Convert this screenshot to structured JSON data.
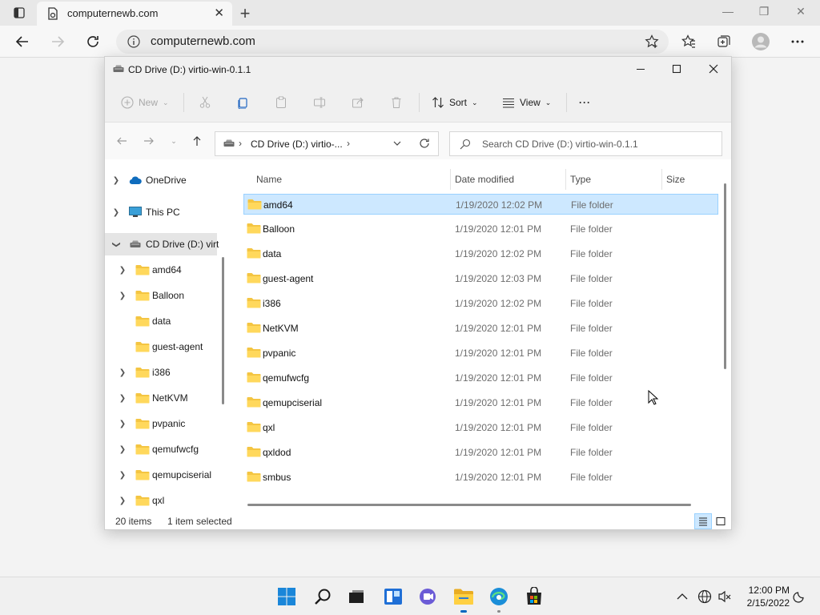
{
  "browser": {
    "tab_title": "computernewb.com",
    "url": "computernewb.com"
  },
  "explorer": {
    "title": "CD Drive (D:) virtio-win-0.1.1",
    "toolbar": {
      "new_label": "New",
      "sort_label": "Sort",
      "view_label": "View",
      "more_label": "···"
    },
    "breadcrumb": "CD Drive (D:) virtio-...",
    "search_placeholder": "Search CD Drive (D:) virtio-win-0.1.1",
    "sidebar": [
      {
        "label": "OneDrive",
        "icon": "onedrive-icon"
      },
      {
        "label": "This PC",
        "icon": "this-pc-icon"
      },
      {
        "label": "CD Drive (D:) virt",
        "icon": "cd-drive-icon"
      },
      {
        "label": "amd64",
        "icon": "folder-icon"
      },
      {
        "label": "Balloon",
        "icon": "folder-icon"
      },
      {
        "label": "data",
        "icon": "folder-icon"
      },
      {
        "label": "guest-agent",
        "icon": "folder-icon"
      },
      {
        "label": "i386",
        "icon": "folder-icon"
      },
      {
        "label": "NetKVM",
        "icon": "folder-icon"
      },
      {
        "label": "pvpanic",
        "icon": "folder-icon"
      },
      {
        "label": "qemufwcfg",
        "icon": "folder-icon"
      },
      {
        "label": "qemupciserial",
        "icon": "folder-icon"
      },
      {
        "label": "qxl",
        "icon": "folder-icon"
      }
    ],
    "columns": {
      "name": "Name",
      "date": "Date modified",
      "type": "Type",
      "size": "Size"
    },
    "files": [
      {
        "name": "amd64",
        "date": "1/19/2020 12:02 PM",
        "type": "File folder"
      },
      {
        "name": "Balloon",
        "date": "1/19/2020 12:01 PM",
        "type": "File folder"
      },
      {
        "name": "data",
        "date": "1/19/2020 12:02 PM",
        "type": "File folder"
      },
      {
        "name": "guest-agent",
        "date": "1/19/2020 12:03 PM",
        "type": "File folder"
      },
      {
        "name": "i386",
        "date": "1/19/2020 12:02 PM",
        "type": "File folder"
      },
      {
        "name": "NetKVM",
        "date": "1/19/2020 12:01 PM",
        "type": "File folder"
      },
      {
        "name": "pvpanic",
        "date": "1/19/2020 12:01 PM",
        "type": "File folder"
      },
      {
        "name": "qemufwcfg",
        "date": "1/19/2020 12:01 PM",
        "type": "File folder"
      },
      {
        "name": "qemupciserial",
        "date": "1/19/2020 12:01 PM",
        "type": "File folder"
      },
      {
        "name": "qxl",
        "date": "1/19/2020 12:01 PM",
        "type": "File folder"
      },
      {
        "name": "qxldod",
        "date": "1/19/2020 12:01 PM",
        "type": "File folder"
      },
      {
        "name": "smbus",
        "date": "1/19/2020 12:01 PM",
        "type": "File folder"
      }
    ],
    "status": {
      "item_count": "20 items",
      "selected": "1 item selected"
    }
  },
  "taskbar": {
    "time": "12:00 PM",
    "date": "2/15/2022"
  },
  "colors": {
    "selection": "#cde8ff",
    "selection_border": "#99d1ff",
    "folder": "#f4c542",
    "accent": "#0067c0"
  }
}
